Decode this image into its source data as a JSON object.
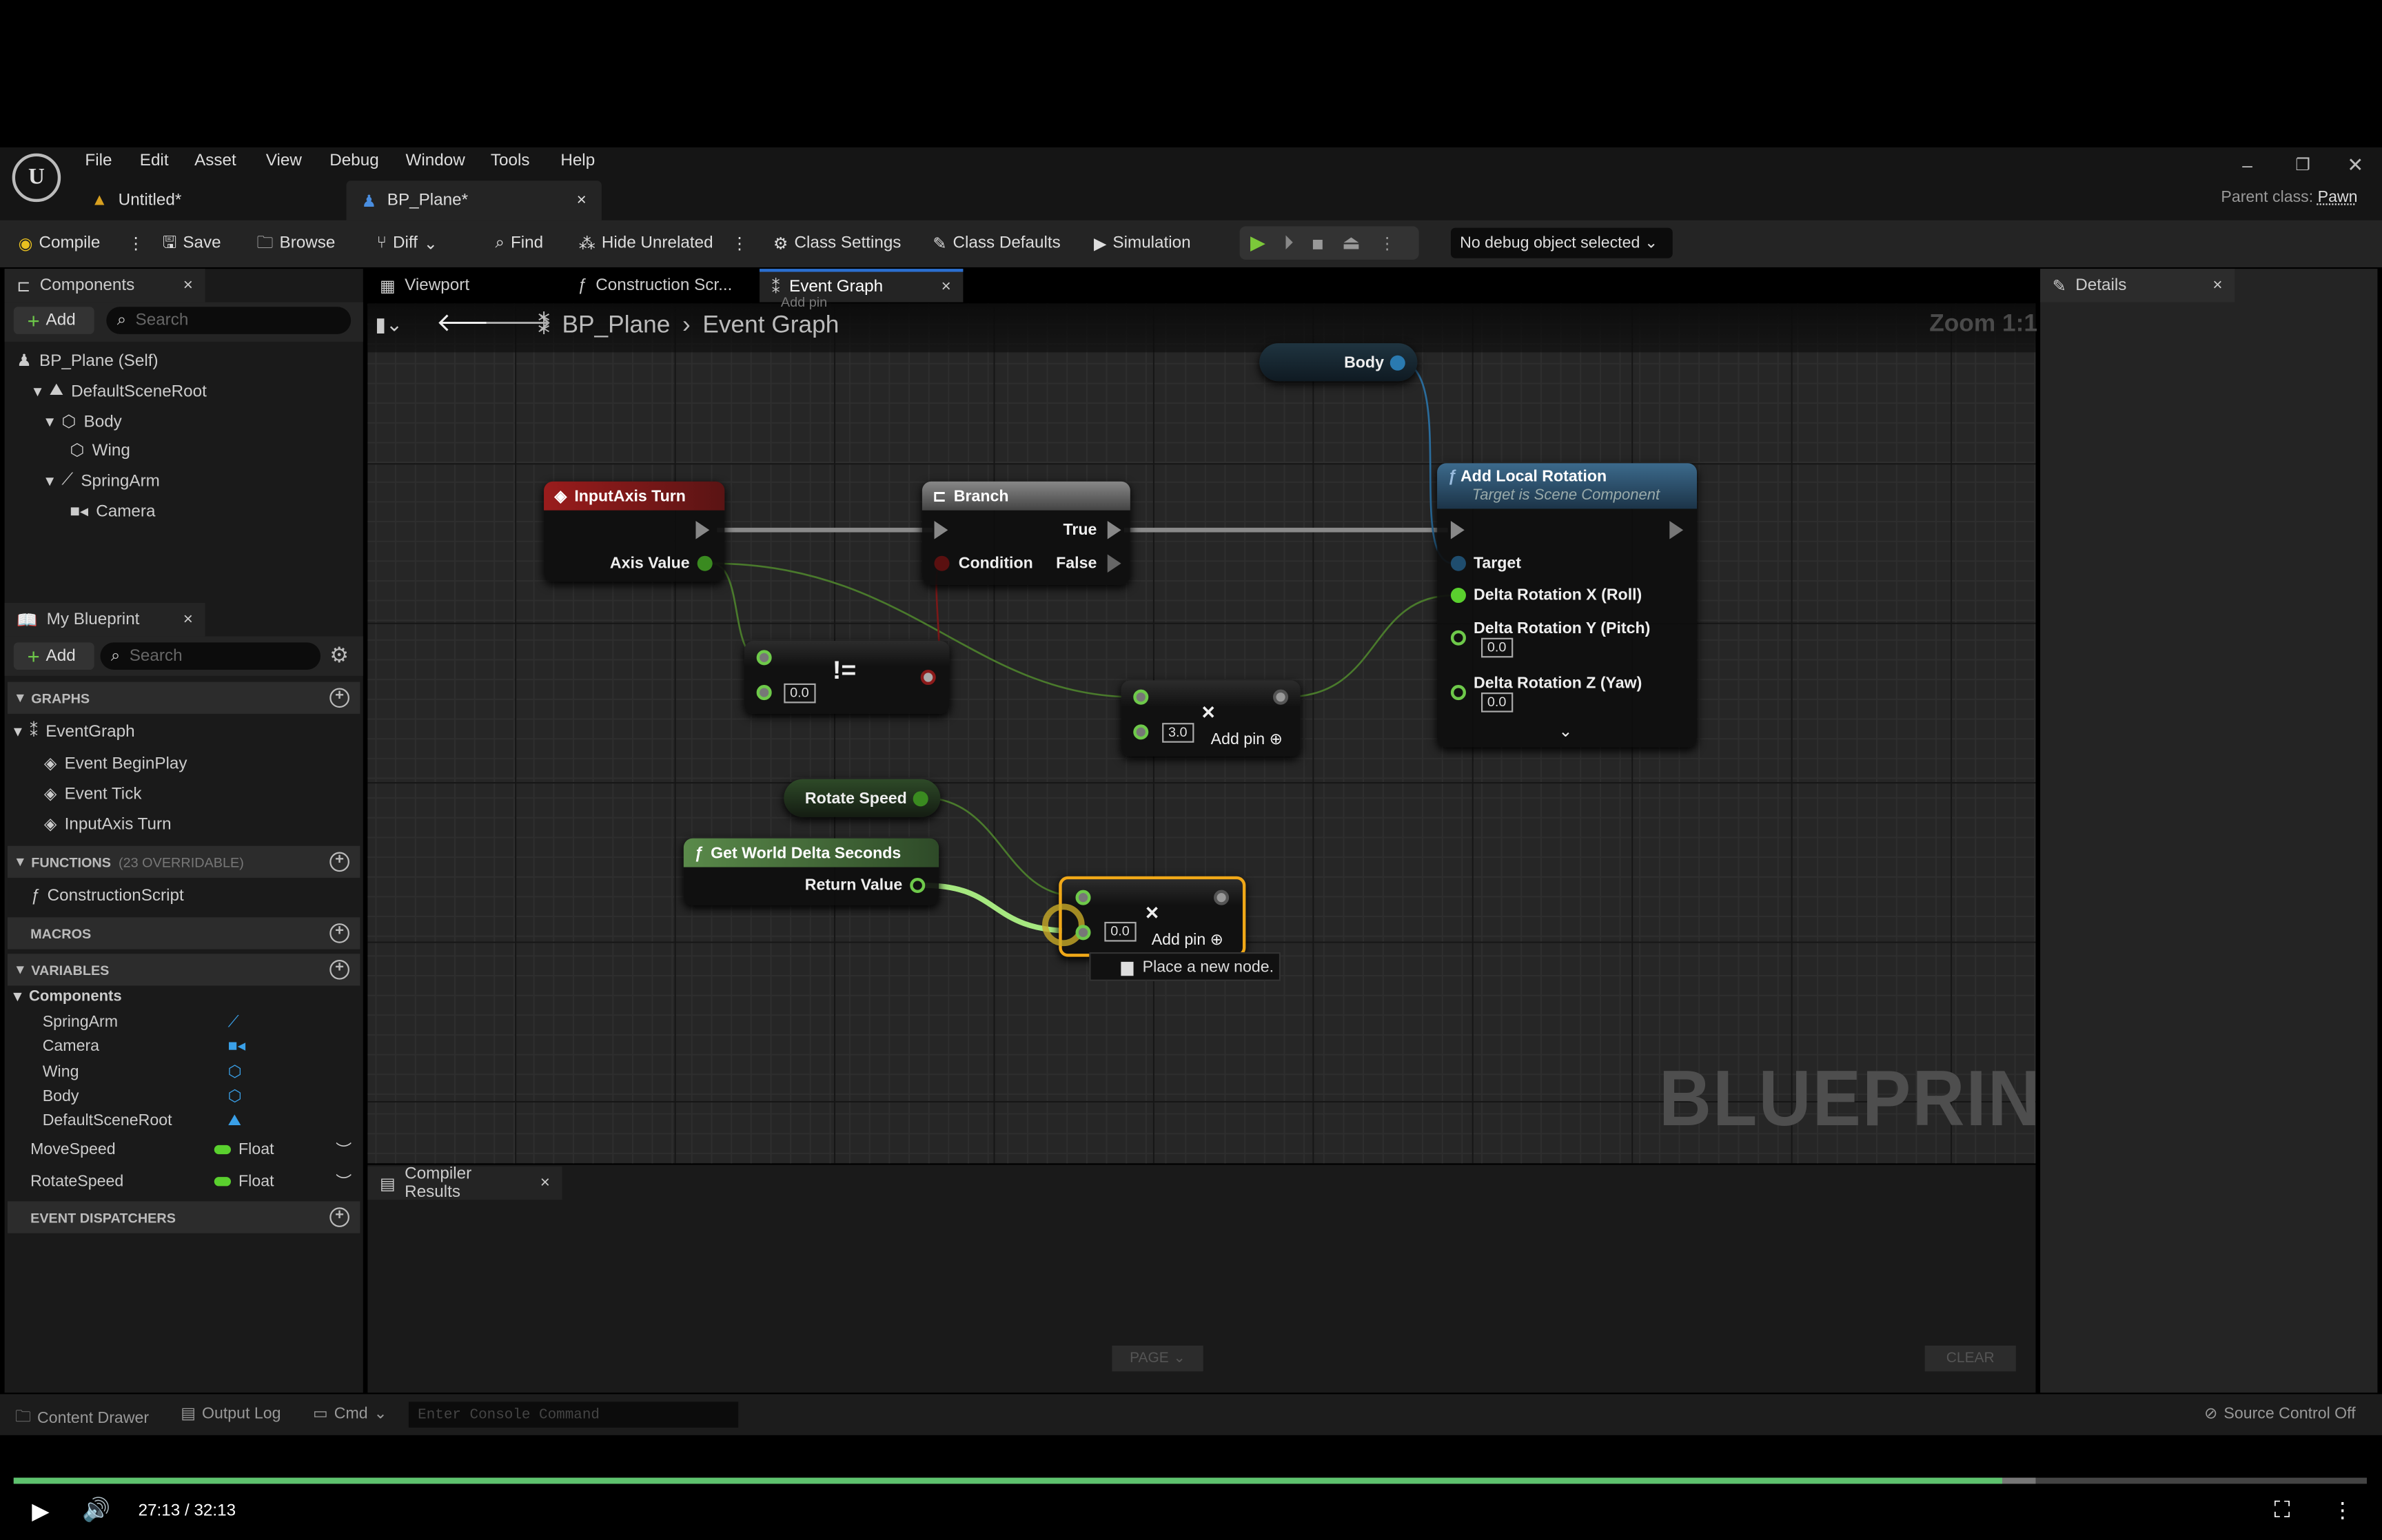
{
  "menu": [
    "File",
    "Edit",
    "Asset",
    "View",
    "Debug",
    "Window",
    "Tools",
    "Help"
  ],
  "doc_tabs": [
    {
      "label": "Untitled*"
    },
    {
      "label": "BP_Plane*",
      "active": true
    }
  ],
  "parent_class": {
    "label": "Parent class:",
    "value": "Pawn"
  },
  "toolbar": {
    "compile": "Compile",
    "save": "Save",
    "browse": "Browse",
    "diff": "Diff",
    "find": "Find",
    "hide_unrelated": "Hide Unrelated",
    "class_settings": "Class Settings",
    "class_defaults": "Class Defaults",
    "simulation": "Simulation",
    "debug_object": "No debug object selected"
  },
  "components": {
    "title": "Components",
    "add": "Add",
    "search_placeholder": "Search",
    "tree": [
      "BP_Plane (Self)",
      "DefaultSceneRoot",
      "Body",
      "Wing",
      "SpringArm",
      "Camera"
    ]
  },
  "editor_tabs": [
    "Viewport",
    "Construction Scr...",
    "Event Graph"
  ],
  "breadcrumb": {
    "root": "BP_Plane",
    "current": "Event Graph"
  },
  "zoom": "Zoom 1:1",
  "watermark": "BLUEPRINT",
  "my_blueprint": {
    "title": "My Blueprint",
    "add": "Add",
    "search_placeholder": "Search",
    "graphs_label": "GRAPHS",
    "event_graph": "EventGraph",
    "events": [
      "Event BeginPlay",
      "Event Tick",
      "InputAxis Turn"
    ],
    "functions_label": "FUNCTIONS",
    "functions_note": "(23 OVERRIDABLE)",
    "construction_script": "ConstructionScript",
    "macros_label": "MACROS",
    "variables_label": "VARIABLES",
    "components_group": "Components",
    "component_vars": [
      "SpringArm",
      "Camera",
      "Wing",
      "Body",
      "DefaultSceneRoot"
    ],
    "variables": [
      {
        "name": "MoveSpeed",
        "type": "Float"
      },
      {
        "name": "RotateSpeed",
        "type": "Float"
      }
    ],
    "dispatchers_label": "EVENT DISPATCHERS"
  },
  "nodes": {
    "body": "Body",
    "input_axis": {
      "title": "InputAxis Turn",
      "axis_value": "Axis Value"
    },
    "branch": {
      "title": "Branch",
      "true": "True",
      "false": "False",
      "condition": "Condition"
    },
    "add_local_rotation": {
      "title": "Add Local Rotation",
      "subtitle": "Target is Scene Component",
      "target": "Target",
      "x": "Delta Rotation X (Roll)",
      "y": "Delta Rotation Y (Pitch)",
      "y_val": "0.0",
      "z": "Delta Rotation Z (Yaw)",
      "z_val": "0.0"
    },
    "not_equal": {
      "symbol": "!=",
      "b_val": "0.0"
    },
    "multiply1": {
      "symbol": "×",
      "b_val": "3.0",
      "add_pin": "Add pin"
    },
    "rotate_speed": "Rotate Speed",
    "delta_seconds": {
      "title": "Get World Delta Seconds",
      "return_value": "Return Value"
    },
    "multiply2": {
      "symbol": "×",
      "b_val": "0.0",
      "add_pin": "Add pin"
    },
    "tooltip": "Place a new node.",
    "ghost_add_pin": "Add pin"
  },
  "compiler": {
    "title": "Compiler Results",
    "page": "PAGE",
    "clear": "CLEAR"
  },
  "details": {
    "title": "Details"
  },
  "statusbar": {
    "content_drawer": "Content Drawer",
    "output_log": "Output Log",
    "cmd": "Cmd",
    "console_placeholder": "Enter Console Command",
    "source_control": "Source Control Off"
  },
  "video": {
    "time": "27:13 / 32:13",
    "progress_percent": 84.5,
    "buffered_percent": 85.9
  },
  "colors": {
    "accent_green": "#5ec26e",
    "exec": "#9a9a9a",
    "float_pin": "#5ad02e",
    "bool_pin": "#8b1a1a",
    "object_pin": "#2a8fd0",
    "selected": "#f0a818"
  }
}
